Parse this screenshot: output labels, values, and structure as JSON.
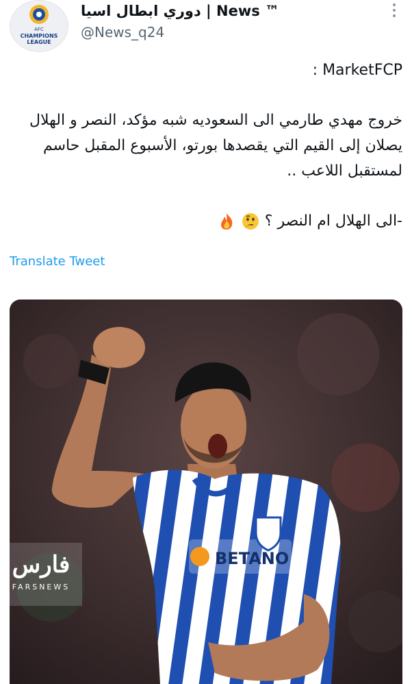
{
  "account": {
    "display_name": "دوري ابطال اسيا | News ™",
    "handle": "@News_q24",
    "avatar_text_top": "AFC",
    "avatar_text_mid": "CHAMPIONS",
    "avatar_text_bottom": "LEAGUE"
  },
  "tweet": {
    "line_source": "MarketFCP :",
    "paragraph": "خروج مهدي طارمي الى السعوديه شبه مؤكد، النصر و الهلال يصلان إلى القيم التي يقصدها بورتو، الأسبوع المقبل حاسم لمستقبل اللاعب ..",
    "question": "-الى الهلال ام النصر ؟",
    "translate_label": "Translate Tweet"
  },
  "media": {
    "sponsor_text": "BETANO",
    "watermark_logo": "فارس",
    "watermark_text": "FARSNEWS"
  },
  "colors": {
    "link": "#1d9bf0",
    "text": "#0f1419",
    "secondary": "#536471",
    "jersey_blue": "#1f4fb0"
  }
}
